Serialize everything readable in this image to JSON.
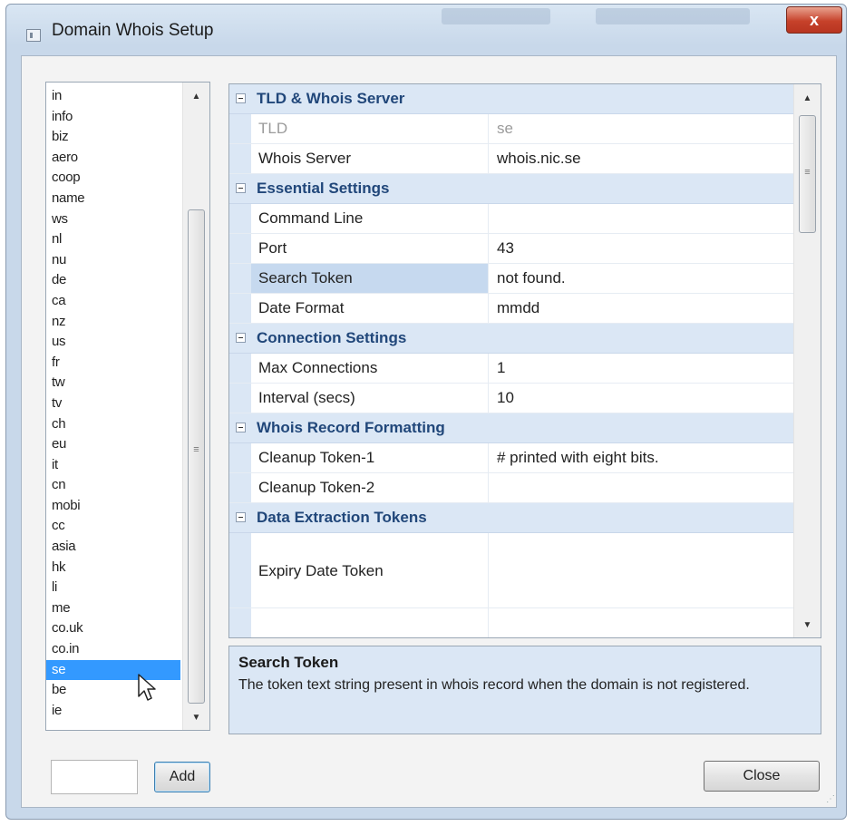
{
  "window": {
    "title": "Domain Whois Setup",
    "close_glyph": "x",
    "title_icon": "app-window-icon"
  },
  "tld_list": {
    "items": [
      "in",
      "info",
      "biz",
      "aero",
      "coop",
      "name",
      "ws",
      "nl",
      "nu",
      "de",
      "ca",
      "nz",
      "us",
      "fr",
      "tw",
      "tv",
      "ch",
      "eu",
      "it",
      "cn",
      "mobi",
      "cc",
      "asia",
      "hk",
      "li",
      "me",
      "co.uk",
      "co.in",
      "se",
      "be",
      "ie"
    ],
    "selected": "se"
  },
  "property_grid": {
    "selected_property": "Search Token",
    "categories": [
      {
        "label": "TLD & Whois Server",
        "props": [
          {
            "name": "TLD",
            "value": "se",
            "dim": true
          },
          {
            "name": "Whois Server",
            "value": "whois.nic.se"
          }
        ]
      },
      {
        "label": "Essential Settings",
        "props": [
          {
            "name": "Command Line",
            "value": ""
          },
          {
            "name": "Port",
            "value": "43"
          },
          {
            "name": "Search Token",
            "value": "not found."
          },
          {
            "name": "Date Format",
            "value": "mmdd"
          }
        ]
      },
      {
        "label": "Connection Settings",
        "props": [
          {
            "name": "Max Connections",
            "value": "1"
          },
          {
            "name": "Interval (secs)",
            "value": "10"
          }
        ]
      },
      {
        "label": "Whois Record Formatting",
        "props": [
          {
            "name": "Cleanup Token-1",
            "value": "# printed with eight bits."
          },
          {
            "name": "Cleanup Token-2",
            "value": ""
          }
        ]
      },
      {
        "label": "Data Extraction Tokens",
        "props": [
          {
            "name": "Expiry Date Token",
            "value": "",
            "tall": true
          },
          {
            "name": "",
            "value": ""
          }
        ]
      }
    ]
  },
  "help": {
    "title": "Search Token",
    "description": "The token text string present in whois record when the domain is not registered."
  },
  "bottom": {
    "add_label": "Add",
    "close_label": "Close",
    "new_tld_value": ""
  },
  "colors": {
    "selection": "#3399ff",
    "category_bg": "#dbe7f5",
    "category_text": "#21477a",
    "window_frame": "#c8d8ea",
    "close_button": "#c6412a"
  }
}
